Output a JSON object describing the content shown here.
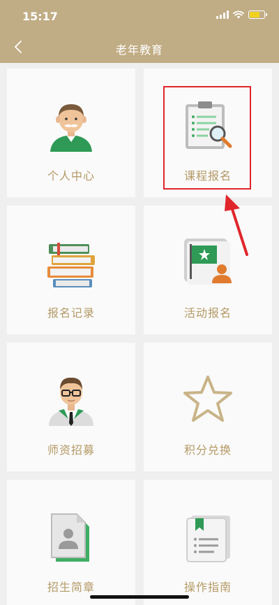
{
  "status_bar": {
    "time": "15:17",
    "battery_level": 0.7
  },
  "nav": {
    "title": "老年教育",
    "back_icon": "chevron-left-icon"
  },
  "colors": {
    "header": "#c1ad85",
    "label": "#b49a66",
    "highlight": "#e0262b",
    "battery": "#f2d21f"
  },
  "tiles": [
    {
      "label": "个人中心",
      "icon": "user-avatar-icon"
    },
    {
      "label": "课程报名",
      "icon": "clipboard-search-icon"
    },
    {
      "label": "报名记录",
      "icon": "book-stack-icon"
    },
    {
      "label": "活动报名",
      "icon": "flag-person-icon"
    },
    {
      "label": "师资招募",
      "icon": "teacher-icon"
    },
    {
      "label": "积分兑换",
      "icon": "star-icon"
    },
    {
      "label": "招生简章",
      "icon": "document-person-icon"
    },
    {
      "label": "操作指南",
      "icon": "guide-book-icon"
    }
  ]
}
